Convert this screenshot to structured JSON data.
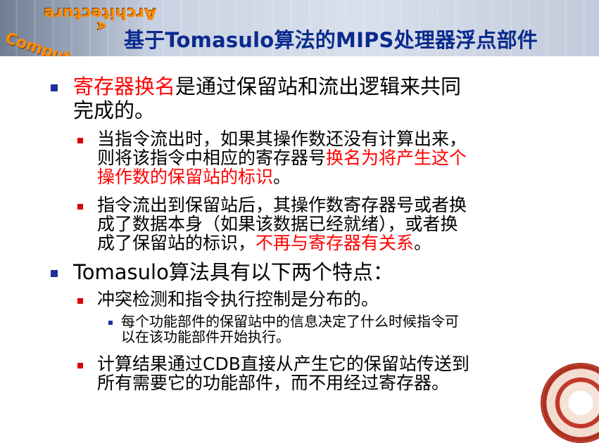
{
  "header": {
    "title": "基于Tomasulo算法的MIPS处理器浮点部件",
    "logo": {
      "text_top": "Architecture",
      "text_left": "Computer",
      "text_bottom": "Computer Ar"
    }
  },
  "content": {
    "bullet1": {
      "red": "寄存器换名",
      "rest_line1": "是通过保留站和流出逻辑来共同",
      "line2": "完成的。"
    },
    "bullet1_sub1": {
      "line1": "当指令流出时，如果其操作数还没有计算出来，",
      "line2_black": "则将该指令中相应的寄存器号",
      "line2_red": "换名为将产生这个",
      "line3_red": "操作数的保留站的标识",
      "line3_black": "。"
    },
    "bullet1_sub2": {
      "line1": "指令流出到保留站后，其操作数寄存器号或者换",
      "line2": "成了数据本身（如果该数据已经就绪），或者换",
      "line3_black": "成了保留站的标识，",
      "line3_red": "不再与寄存器有关系",
      "line3_end": "。"
    },
    "bullet2": {
      "text": "Tomasulo算法具有以下两个特点："
    },
    "bullet2_sub1": {
      "text": "冲突检测和指令执行控制是分布的。"
    },
    "bullet2_sub1_sub": {
      "line1": "每个功能部件的保留站中的信息决定了什么时候指令可",
      "line2": "以在该功能部件开始执行。"
    },
    "bullet2_sub2": {
      "line1": "计算结果通过CDB直接从产生它的保留站传送到",
      "line2": "所有需要它的功能部件，而不用经过寄存器。"
    }
  },
  "colors": {
    "title": "#0a2a8e",
    "emphasis": "#ff0000",
    "bullet_level1": "#1f2f9a",
    "bullet_level2": "#d80000"
  },
  "icons": {
    "logo": "computer-architecture-logo",
    "seal": "university-seal"
  }
}
